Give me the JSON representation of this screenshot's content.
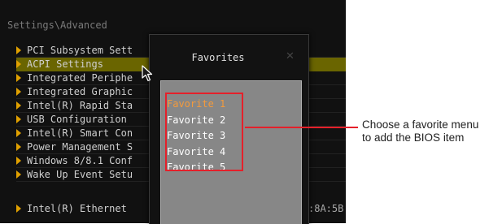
{
  "bios": {
    "breadcrumb": "Settings\\Advanced",
    "menu_items": [
      {
        "label": "PCI Subsystem Sett"
      },
      {
        "label": "ACPI Settings"
      },
      {
        "label": "Integrated Periphe"
      },
      {
        "label": "Integrated Graphic"
      },
      {
        "label": "Intel(R) Rapid Sta"
      },
      {
        "label": "USB Configuration"
      },
      {
        "label": "Intel(R) Smart Con"
      },
      {
        "label": "Power Management S"
      },
      {
        "label": "Windows 8/8.1 Conf"
      },
      {
        "label": "Wake Up Event Setu"
      }
    ],
    "selected_index": 1,
    "ethernet_label": "Intel(R) Ethernet",
    "mac_fragment": ":8A:5B:",
    "chevron_icon": "chevron-right-icon",
    "colors": {
      "accent": "#e0a000",
      "selected_row": "#6a6500"
    }
  },
  "dialog": {
    "title": "Favorites",
    "close_icon": "close-icon",
    "items": [
      "Favorite 1",
      "Favorite 2",
      "Favorite 3",
      "Favorite 4",
      "Favorite 5"
    ],
    "active_index": 0,
    "colors": {
      "active_item": "#f39a3c",
      "panel_bg": "#878787"
    }
  },
  "callout": {
    "line1": "Choose a favorite menu",
    "line2": "to add the BIOS item",
    "color": "#e5202a"
  },
  "cursor_icon": "mouse-pointer-icon"
}
